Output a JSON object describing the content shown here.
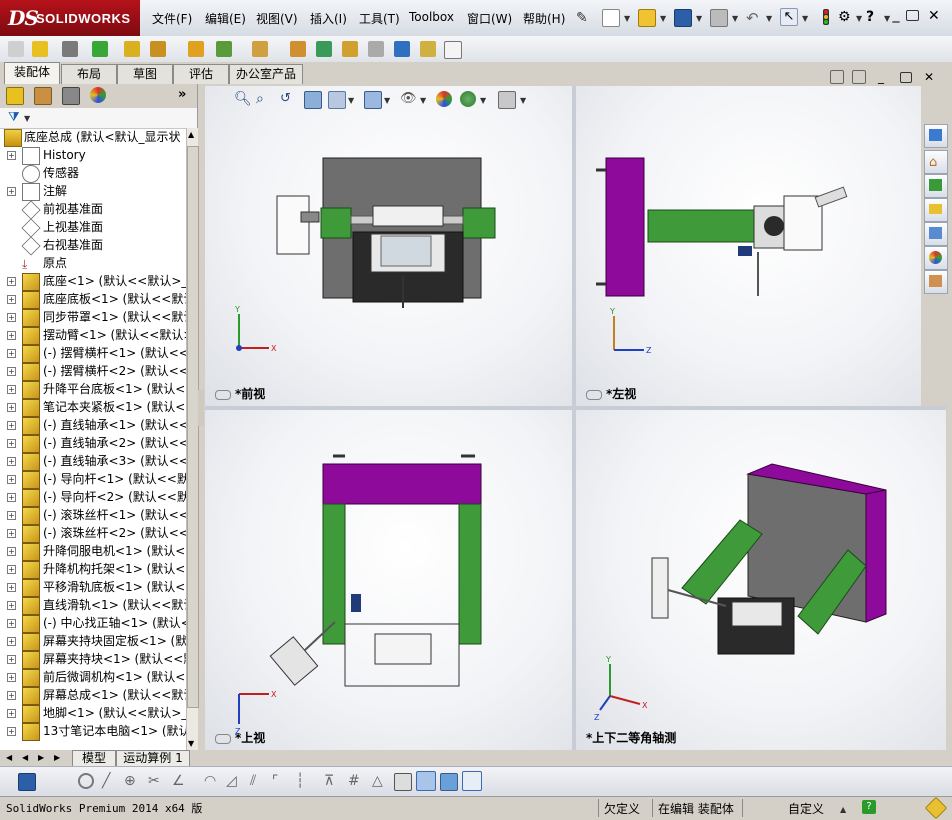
{
  "app": {
    "brand_ds": "DS",
    "brand_name": "SOLIDWORKS",
    "menus": [
      "文件(F)",
      "编辑(E)",
      "视图(V)",
      "插入(I)",
      "工具(T)",
      "Toolbox",
      "窗口(W)",
      "帮助(H)"
    ]
  },
  "command_tabs": [
    "装配体",
    "布局",
    "草图",
    "评估",
    "办公室产品"
  ],
  "tree": {
    "root": "底座总成  (默认<默认_显示状",
    "items": [
      {
        "label": "History",
        "icon": "history-icon",
        "expand": true
      },
      {
        "label": "传感器",
        "icon": "sensor-icon",
        "expand": false
      },
      {
        "label": "注解",
        "icon": "annotation-icon",
        "expand": true
      },
      {
        "label": "前视基准面",
        "icon": "plane-icon",
        "expand": false
      },
      {
        "label": "上视基准面",
        "icon": "plane-icon",
        "expand": false
      },
      {
        "label": "右视基准面",
        "icon": "plane-icon",
        "expand": false
      },
      {
        "label": "原点",
        "icon": "origin-icon",
        "expand": false
      },
      {
        "label": "底座<1> (默认<<默认>_显",
        "icon": "part-icon",
        "expand": true
      },
      {
        "label": "底座底板<1> (默认<<默认",
        "icon": "part-icon",
        "expand": true
      },
      {
        "label": "同步带罩<1> (默认<<默认",
        "icon": "part-icon",
        "expand": true
      },
      {
        "label": "摆动臂<1> (默认<<默认>_",
        "icon": "part-icon",
        "expand": true
      },
      {
        "label": "(-) 摆臂横杆<1> (默认<<",
        "icon": "part-icon",
        "expand": true
      },
      {
        "label": "(-) 摆臂横杆<2> (默认<<",
        "icon": "part-icon",
        "expand": true
      },
      {
        "label": "升降平台底板<1> (默认<<",
        "icon": "part-icon",
        "expand": true
      },
      {
        "label": "笔记本夹紧板<1> (默认<<",
        "icon": "part-icon",
        "expand": true
      },
      {
        "label": "(-) 直线轴承<1> (默认<<",
        "icon": "part-icon",
        "expand": true
      },
      {
        "label": "(-) 直线轴承<2> (默认<<",
        "icon": "part-icon",
        "expand": true
      },
      {
        "label": "(-) 直线轴承<3> (默认<<",
        "icon": "part-icon",
        "expand": true
      },
      {
        "label": "(-) 导向杆<1> (默认<<默",
        "icon": "part-icon",
        "expand": true
      },
      {
        "label": "(-) 导向杆<2> (默认<<默",
        "icon": "part-icon",
        "expand": true
      },
      {
        "label": "(-) 滚珠丝杆<1> (默认<<",
        "icon": "part-icon",
        "expand": true
      },
      {
        "label": "(-) 滚珠丝杆<2> (默认<<",
        "icon": "part-icon",
        "expand": true
      },
      {
        "label": "升降伺服电机<1> (默认<<",
        "icon": "part-icon",
        "expand": true
      },
      {
        "label": "升降机构托架<1> (默认<<",
        "icon": "part-icon",
        "expand": true
      },
      {
        "label": "平移滑轨底板<1> (默认<<",
        "icon": "part-icon",
        "expand": true
      },
      {
        "label": "直线滑轨<1> (默认<<默认",
        "icon": "part-icon",
        "expand": true
      },
      {
        "label": "(-) 中心找正轴<1> (默认<",
        "icon": "part-icon",
        "expand": true
      },
      {
        "label": "屏幕夹持块固定板<1> (默",
        "icon": "part-icon",
        "expand": true
      },
      {
        "label": "屏幕夹持块<1> (默认<<默",
        "icon": "part-icon",
        "expand": true
      },
      {
        "label": "前后微调机构<1> (默认<<",
        "icon": "part-icon",
        "expand": true
      },
      {
        "label": "屏幕总成<1> (默认<<默认",
        "icon": "part-icon",
        "expand": true
      },
      {
        "label": "地脚<1> (默认<<默认>_显",
        "icon": "part-icon",
        "expand": true
      },
      {
        "label": "13寸笔记本电脑<1> (默认",
        "icon": "part-icon",
        "expand": true
      }
    ]
  },
  "viewports": [
    {
      "label": "*前视",
      "axes": [
        "Y",
        "X"
      ]
    },
    {
      "label": "*左视",
      "axes": [
        "Y",
        "Z"
      ]
    },
    {
      "label": "*上视",
      "axes": [
        "X",
        "Z"
      ]
    },
    {
      "label": "*上下二等角轴测",
      "axes": [
        "Y",
        "X",
        "Z"
      ]
    }
  ],
  "bottom_tabs": [
    "模型",
    "运动算例 1"
  ],
  "status": {
    "product": "SolidWorks Premium 2014 x64 版",
    "constraint": "欠定义",
    "mode": "在编辑 装配体",
    "units": "自定义"
  },
  "colors": {
    "purple": "#8e0a9a",
    "green": "#3f9a3a",
    "gray_plate": "#6e6e6e",
    "dark_frame": "#2a2a2a",
    "brand_red": "#b6121b"
  }
}
